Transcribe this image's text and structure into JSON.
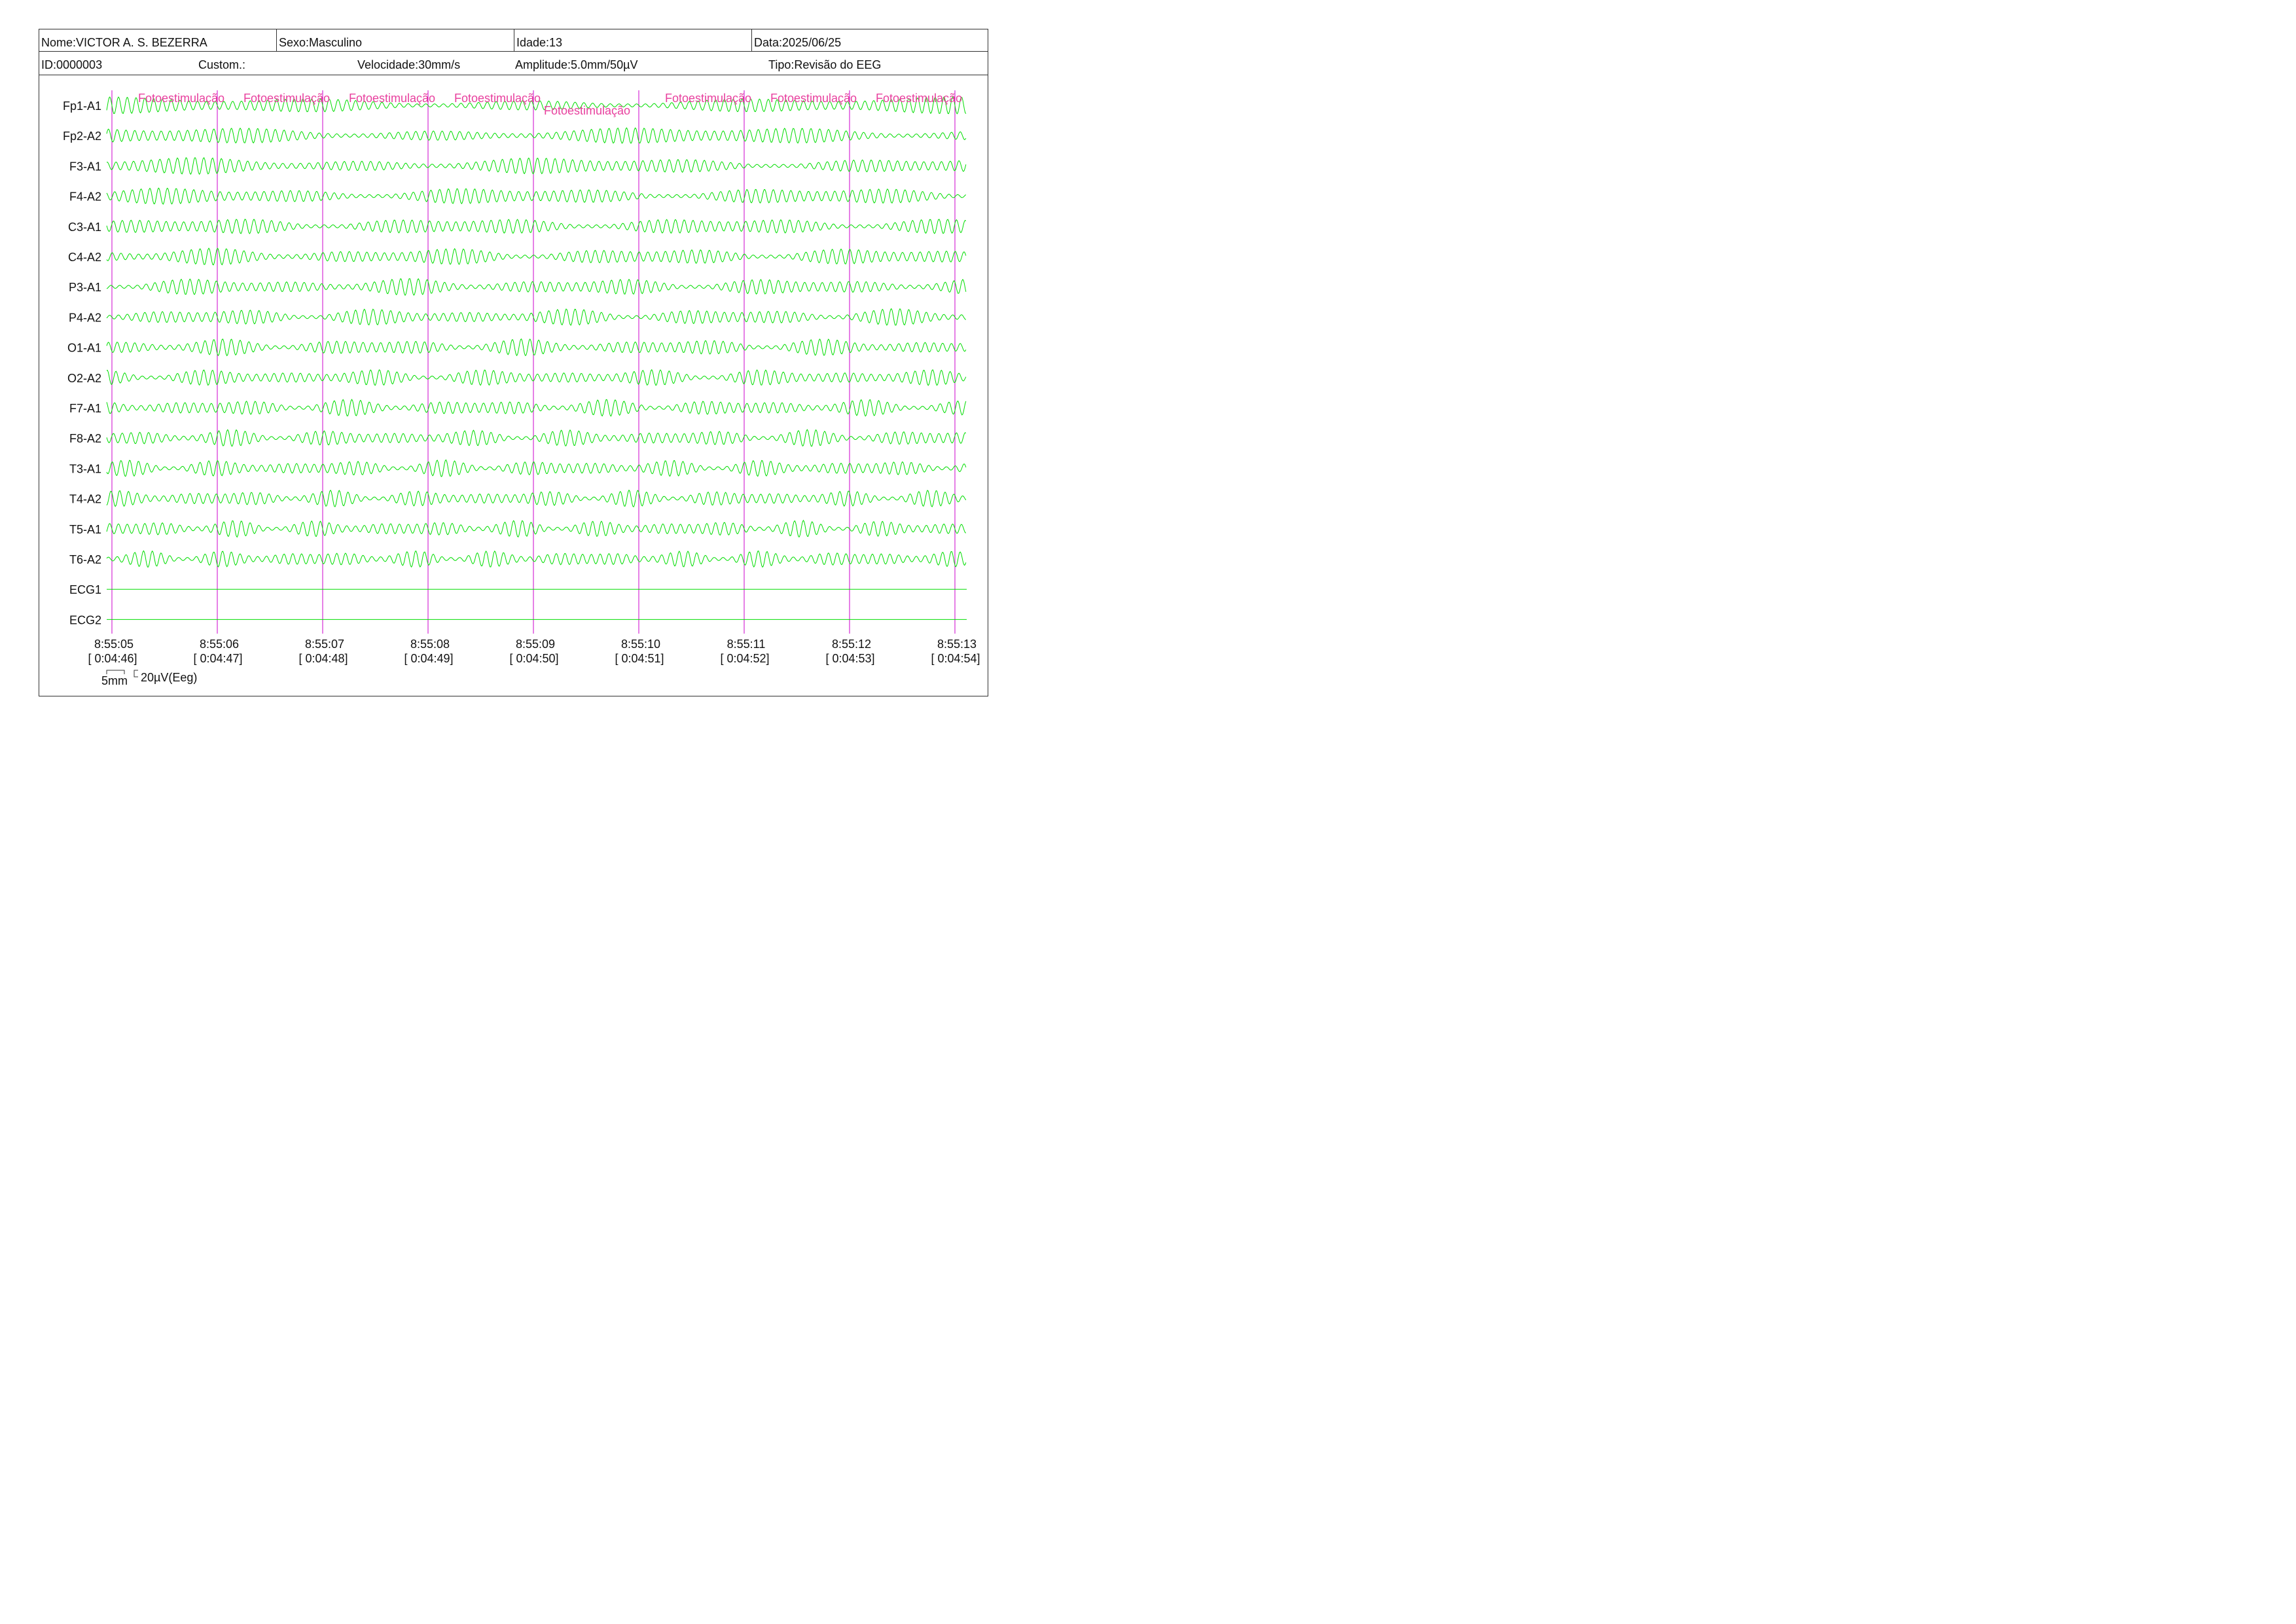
{
  "header": {
    "nome": "Nome:VICTOR A. S. BEZERRA",
    "sexo": "Sexo:Masculino",
    "idade": "Idade:13",
    "data": "Data:2025/06/25",
    "id": "ID:0000003",
    "custom": "Custom.:",
    "velocidade": "Velocidade:30mm/s",
    "amplitude": "Amplitude:5.0mm/50µV",
    "tipo": "Tipo:Revisão do EEG"
  },
  "colors": {
    "trace": "#00dd00",
    "marker": "#cc00cc",
    "marker_text": "#e8409e",
    "text": "#111111"
  },
  "scale_bar": {
    "time_label": "5mm",
    "amp_label": "20µV(Eeg)"
  },
  "chart_data": {
    "type": "line",
    "channels": [
      "Fp1-A1",
      "Fp2-A2",
      "F3-A1",
      "F4-A2",
      "C3-A1",
      "C4-A2",
      "P3-A1",
      "P4-A2",
      "O1-A1",
      "O2-A2",
      "F7-A1",
      "F8-A2",
      "T3-A1",
      "T4-A2",
      "T5-A1",
      "T6-A2",
      "ECG1",
      "ECG2"
    ],
    "time_ticks": [
      {
        "clock": "8:55:05",
        "elapsed": "[ 0:04:46]"
      },
      {
        "clock": "8:55:06",
        "elapsed": "[ 0:04:47]"
      },
      {
        "clock": "8:55:07",
        "elapsed": "[ 0:04:48]"
      },
      {
        "clock": "8:55:08",
        "elapsed": "[ 0:04:49]"
      },
      {
        "clock": "8:55:09",
        "elapsed": "[ 0:04:50]"
      },
      {
        "clock": "8:55:10",
        "elapsed": "[ 0:04:51]"
      },
      {
        "clock": "8:55:11",
        "elapsed": "[ 0:04:52]"
      },
      {
        "clock": "8:55:12",
        "elapsed": "[ 0:04:53]"
      },
      {
        "clock": "8:55:13",
        "elapsed": "[ 0:04:54]"
      }
    ],
    "events": [
      {
        "label": "Fotoestimulação",
        "start_s": 0.0,
        "row": "top"
      },
      {
        "label": "Fotoestimulação",
        "start_s": 1.0,
        "row": "top"
      },
      {
        "label": "Fotoestimulação",
        "start_s": 2.0,
        "row": "top"
      },
      {
        "label": "Fotoestimulação",
        "start_s": 3.0,
        "row": "top"
      },
      {
        "label": "Fotoestimulação",
        "start_s": 4.0,
        "row": "low"
      },
      {
        "label": "Fotoestimulação",
        "start_s": 5.0,
        "row": "top"
      },
      {
        "label": "Fotoestimulação",
        "start_s": 6.0,
        "row": "top"
      },
      {
        "label": "Fotoestimulação",
        "start_s": 7.0,
        "row": "top"
      }
    ],
    "signal": {
      "approx_frequency_hz": 12,
      "duration_s": 8.1,
      "ecg_flat": true
    },
    "grid": false,
    "legend": "none"
  }
}
